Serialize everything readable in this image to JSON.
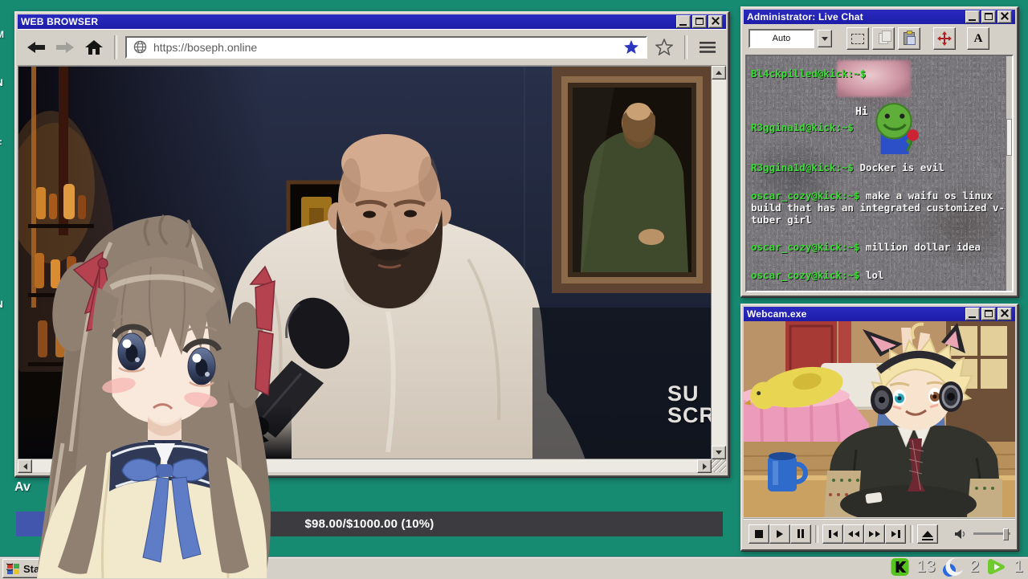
{
  "desktop": {
    "background_color": "#178a72",
    "icon_label_fragments": [
      "M",
      "N",
      "F",
      "N"
    ]
  },
  "browser": {
    "title": "WEB BROWSER",
    "url": "https://boseph.online",
    "watermark": [
      "SU",
      "SCRI"
    ]
  },
  "goal": {
    "label_fragment": "Av",
    "progress_text": "$98.00/$1000.00 (10%)",
    "fill_color": "#4156ac"
  },
  "chat": {
    "title": "Administrator: Live Chat",
    "toolbar": {
      "dropdown_value": "Auto",
      "font_button_label": "A"
    },
    "user_color": "#3bdc35",
    "messages": [
      {
        "user": "Bl4ckpilled@kick:~$",
        "text": ""
      },
      {
        "user": "R3ggina1d@kick:~$",
        "text": "Hi"
      },
      {
        "user": "R3ggina1d@kick:~$",
        "text": "Docker is evil"
      },
      {
        "user": "oscar_cozy@kick:~$",
        "text": "make a waifu os linux build that has an integrated customized v-tuber girl"
      },
      {
        "user": "oscar_cozy@kick:~$",
        "text": "million dollar idea"
      },
      {
        "user": "oscar_cozy@kick:~$",
        "text": "lol"
      }
    ]
  },
  "webcam": {
    "title": "Webcam.exe"
  },
  "taskbar": {
    "start_label": "Start",
    "tray": [
      {
        "icon": "kick-icon",
        "count": "13"
      },
      {
        "icon": "moon-icon",
        "count": "2"
      },
      {
        "icon": "rumble-icon",
        "count": "1"
      }
    ]
  }
}
